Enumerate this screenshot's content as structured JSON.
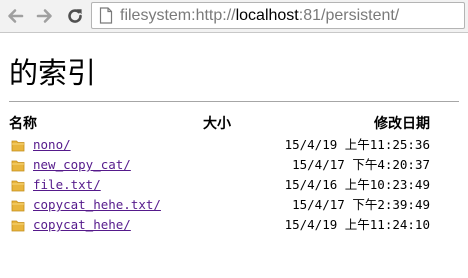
{
  "browser": {
    "address": {
      "scheme": "filesystem:http://",
      "host": "localhost",
      "port_path": ":81/persistent/"
    }
  },
  "page": {
    "heading": "的索引",
    "columns": {
      "name": "名称",
      "size": "大小",
      "modified": "修改日期"
    },
    "entries": [
      {
        "name": "nono/",
        "size": "",
        "modified": "15/4/19 上午11:25:36"
      },
      {
        "name": "new_copy_cat/",
        "size": "",
        "modified": "15/4/17 下午4:20:37"
      },
      {
        "name": "file.txt/",
        "size": "",
        "modified": "15/4/16 上午10:23:49"
      },
      {
        "name": "copycat_hehe.txt/",
        "size": "",
        "modified": "15/4/17 下午2:39:49"
      },
      {
        "name": "copycat_hehe/",
        "size": "",
        "modified": "15/4/19 上午11:24:10"
      }
    ]
  },
  "colors": {
    "link": "#551a8b",
    "folder": "#e8b53e",
    "toolbar": "#f2f2f2"
  },
  "icons": [
    "back-arrow-icon",
    "forward-arrow-icon",
    "reload-icon",
    "page-icon",
    "folder-icon"
  ]
}
